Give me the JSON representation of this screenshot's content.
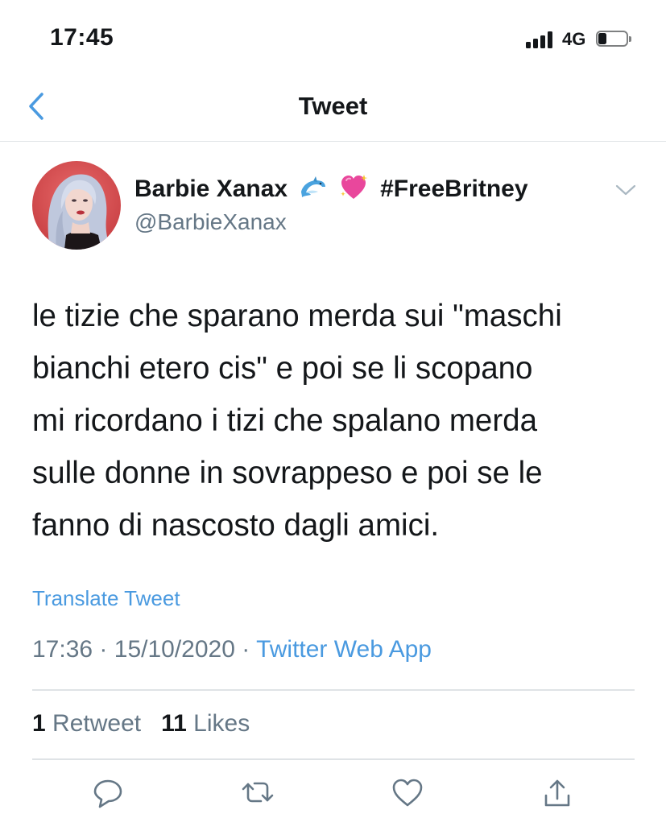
{
  "status_bar": {
    "time": "17:45",
    "network": "4G",
    "signal_icon": "cellular-signal-icon",
    "battery_icon": "battery-icon",
    "battery_level": 0.3
  },
  "nav": {
    "title": "Tweet",
    "back_icon": "chevron-left-icon"
  },
  "tweet": {
    "display_name": "Barbie Xanax",
    "name_emojis": [
      "dolphin-emoji",
      "sparkling-heart-emoji"
    ],
    "hashtag": "#FreeBritney",
    "handle": "@BarbieXanax",
    "more_icon": "chevron-down-icon",
    "text_lines": [
      "le tizie che sparano merda sui \"maschi",
      "bianchi etero cis\" e poi se li scopano",
      "mi ricordano i tizi che spalano merda",
      "sulle donne in sovrappeso e poi se le",
      "fanno di nascosto dagli amici."
    ],
    "translate_label": "Translate Tweet",
    "time": "17:36",
    "date": "15/10/2020",
    "separator": "·",
    "source": "Twitter Web App",
    "retweet_count": "1",
    "retweet_label": "Retweet",
    "like_count": "11",
    "like_label": "Likes"
  },
  "actions": [
    {
      "name": "reply",
      "icon": "reply-icon"
    },
    {
      "name": "retweet",
      "icon": "retweet-icon"
    },
    {
      "name": "like",
      "icon": "heart-icon"
    },
    {
      "name": "share",
      "icon": "share-icon"
    }
  ],
  "colors": {
    "link": "#4a9ae0",
    "secondary_text": "#657786",
    "divider": "#dfe3e6",
    "primary_text": "#14171a"
  }
}
